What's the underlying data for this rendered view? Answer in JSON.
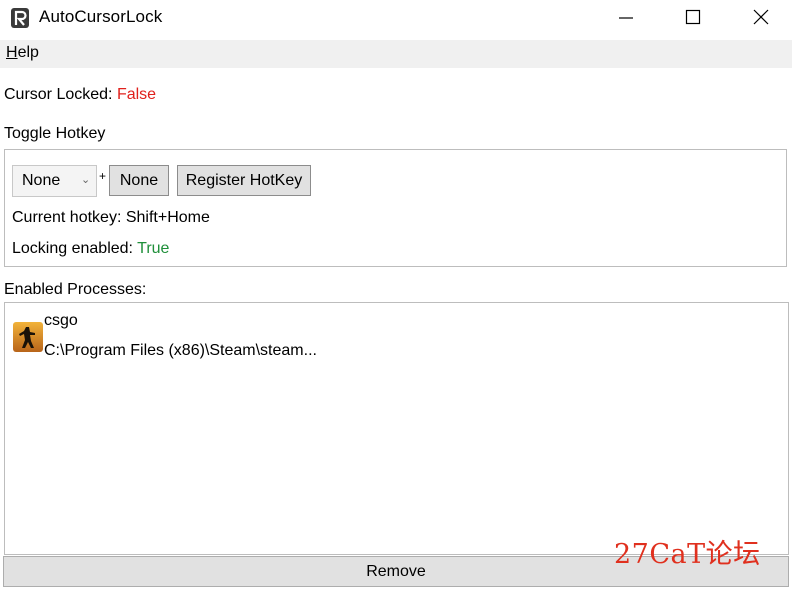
{
  "window": {
    "title": "AutoCursorLock",
    "icon": "lock-app-icon",
    "controls": [
      "minimize-icon",
      "maximize-icon",
      "close-icon"
    ]
  },
  "menu": {
    "help_hotkey_letter": "H",
    "help_rest": "elp"
  },
  "status": {
    "cursor_locked_label": "Cursor Locked: ",
    "cursor_locked_value": "False"
  },
  "hotkey": {
    "section_label": "Toggle Hotkey",
    "modifier_selected": "None",
    "plus": "+",
    "key_button": "None",
    "register_button": "Register HotKey",
    "current_label": "Current hotkey: Shift+Home",
    "locking_label": "Locking enabled: ",
    "locking_value": "True"
  },
  "processes": {
    "section_label": "Enabled Processes:",
    "items": [
      {
        "name": "csgo",
        "path": "C:\\Program Files (x86)\\Steam\\steam...",
        "icon": "csgo-icon"
      }
    ]
  },
  "remove_button": "Remove",
  "watermark": "27CaT论坛",
  "colors": {
    "false": "#e0201c",
    "true": "#1f8f3a",
    "menubar": "#f0f0f0",
    "button": "#e1e1e1"
  }
}
